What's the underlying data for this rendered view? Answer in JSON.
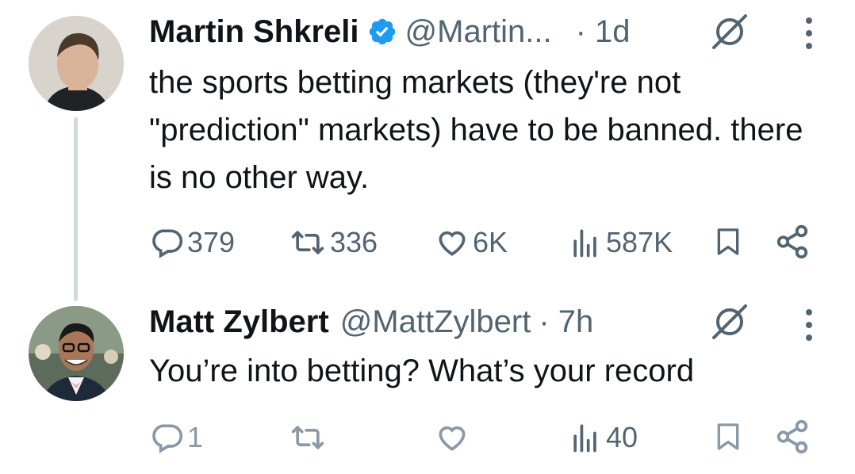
{
  "tweets": [
    {
      "name": "Martin Shkreli",
      "verified": true,
      "handle": "@Martin...",
      "time": "· 1d",
      "text": "the sports betting markets (they're not \"prediction\" markets) have to be banned. there is no other way.",
      "actions": {
        "replies": "379",
        "reposts": "336",
        "likes": "6K",
        "views": "587K"
      }
    },
    {
      "name": "Matt Zylbert",
      "verified": false,
      "handle": "@MattZylbert",
      "time": "· 7h",
      "text": "You’re into betting? What’s your record",
      "actions": {
        "replies": "1",
        "reposts": "",
        "likes": "",
        "views": "40"
      }
    }
  ],
  "colors": {
    "text": "#0f1419",
    "secondary": "#536471",
    "verified_blue": "#1d9bf0",
    "thread_line": "#cfd9de"
  },
  "icons": [
    "verified-badge-icon",
    "grok-icon",
    "more-icon",
    "reply-icon",
    "repost-icon",
    "like-icon",
    "views-icon",
    "bookmark-icon",
    "share-icon"
  ]
}
